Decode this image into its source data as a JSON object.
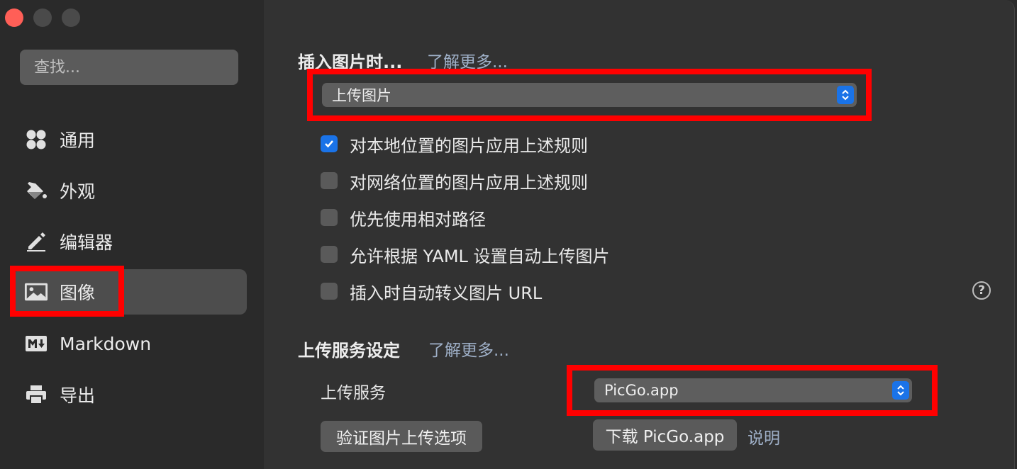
{
  "window_controls": {
    "close": "close-icon",
    "minimize": "minimize-icon",
    "zoom": "zoom-icon"
  },
  "sidebar": {
    "search_placeholder": "查找...",
    "items": [
      {
        "label": "通用",
        "icon": "grid-icon"
      },
      {
        "label": "外观",
        "icon": "paint-bucket-icon"
      },
      {
        "label": "编辑器",
        "icon": "pencil-icon"
      },
      {
        "label": "图像",
        "icon": "image-icon",
        "active": true
      },
      {
        "label": "Markdown",
        "icon": "markdown-icon"
      },
      {
        "label": "导出",
        "icon": "printer-icon"
      }
    ]
  },
  "insert_section": {
    "title": "插入图片时...",
    "learn_more": "了解更多...",
    "action_select": "上传图片",
    "options": [
      {
        "label": "对本地位置的图片应用上述规则",
        "checked": true
      },
      {
        "label": "对网络位置的图片应用上述规则",
        "checked": false
      },
      {
        "label": "优先使用相对路径",
        "checked": false
      },
      {
        "label": "允许根据 YAML 设置自动上传图片",
        "checked": false
      },
      {
        "label": "插入时自动转义图片 URL",
        "checked": false
      }
    ],
    "help": "?"
  },
  "upload_section": {
    "title": "上传服务设定",
    "learn_more": "了解更多...",
    "service_label": "上传服务",
    "service_select": "PicGo.app",
    "verify_button": "验证图片上传选项",
    "download_button": "下载 PicGo.app",
    "explain_link": "说明"
  },
  "colors": {
    "accent": "#1a73e8",
    "highlight": "#ff0000",
    "close": "#ff5f57"
  }
}
